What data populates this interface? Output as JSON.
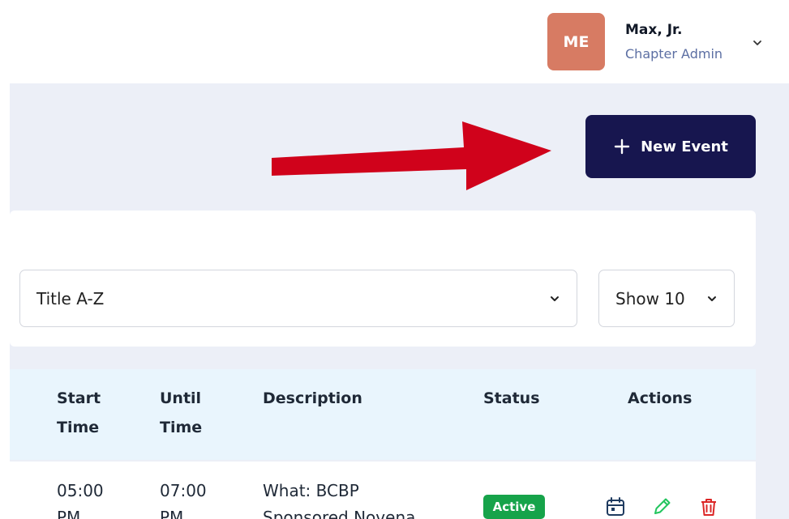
{
  "user": {
    "initials": "ME",
    "name": "Max, Jr.",
    "role": "Chapter Admin",
    "avatar_color": "#d77b63"
  },
  "toolbar": {
    "new_event_label": "New Event",
    "button_color": "#17164f"
  },
  "filters": {
    "sort_value": "Title A-Z",
    "page_size_value": "Show 10"
  },
  "table": {
    "headers": {
      "start_time_line1": "Start",
      "start_time_line2": "Time",
      "until_time_line1": "Until",
      "until_time_line2": "Time",
      "description": "Description",
      "status": "Status",
      "actions": "Actions"
    },
    "rows": [
      {
        "start_time_line1": "05:00",
        "start_time_line2": "PM",
        "until_time_line1": "07:00",
        "until_time_line2": "PM",
        "description_line1": "What: BCBP",
        "description_line2": "Sponsored Novena",
        "status": "Active",
        "status_color": "#16a34a"
      }
    ]
  },
  "annotation": {
    "arrow_color": "#d0021b"
  },
  "icons": [
    "chevron-down-icon",
    "plus-icon",
    "calendar-icon",
    "edit-pencil-icon",
    "trash-icon"
  ]
}
